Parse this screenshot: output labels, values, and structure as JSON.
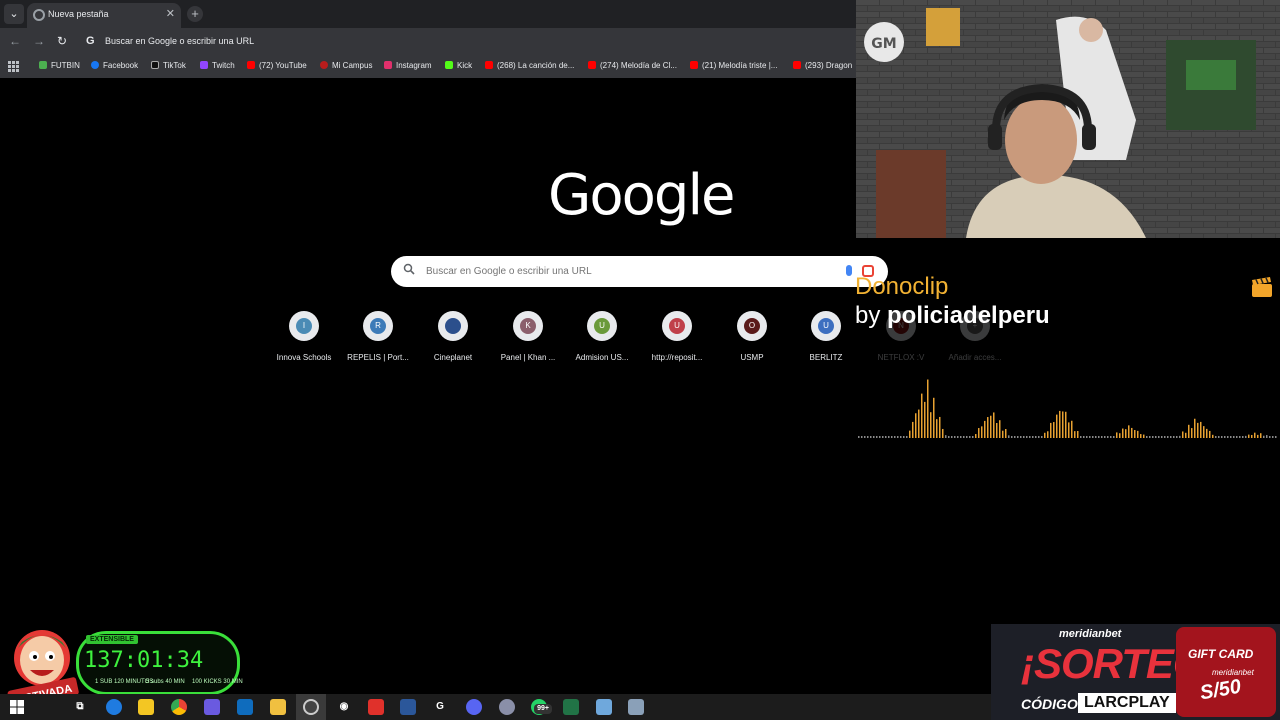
{
  "browser": {
    "tab_title": "Nueva pestaña",
    "tab_close": "✕",
    "new_tab": "+",
    "omnibox_text": "Buscar en Google o escribir una URL",
    "omnibox_g": "G",
    "bookmarks": [
      {
        "label": "FUTBIN",
        "color": "#4caf50"
      },
      {
        "label": "Facebook",
        "color": "#1877f2"
      },
      {
        "label": "TikTok",
        "color": "#000000"
      },
      {
        "label": "Twitch",
        "color": "#9146ff"
      },
      {
        "label": "(72) YouTube",
        "color": "#ff0000"
      },
      {
        "label": "Mi Campus",
        "color": "#b71c1c"
      },
      {
        "label": "Instagram",
        "color": "#e1306c"
      },
      {
        "label": "Kick",
        "color": "#53fc18"
      },
      {
        "label": "(268) La canción de...",
        "color": "#ff0000"
      },
      {
        "label": "(274) Melodía de Cl...",
        "color": "#ff0000"
      },
      {
        "label": "(21) Melodía triste |...",
        "color": "#ff0000"
      },
      {
        "label": "(293) Dragon",
        "color": "#ff0000"
      }
    ]
  },
  "newtab": {
    "logo": "Google",
    "search_placeholder": "Buscar en Google o escribir una URL",
    "shortcuts": [
      {
        "letter": "I",
        "label": "Innova Schools",
        "color": "#4a8bb5"
      },
      {
        "letter": "R",
        "label": "REPELIS | Port...",
        "color": "#3d7bb8"
      },
      {
        "letter": "",
        "label": "Cineplanet",
        "color": "#2b4f8c"
      },
      {
        "letter": "K",
        "label": "Panel | Khan ...",
        "color": "#8b5f6c"
      },
      {
        "letter": "U",
        "label": "Admision US...",
        "color": "#6a9a3a"
      },
      {
        "letter": "U",
        "label": "http://reposit...",
        "color": "#c0404a"
      },
      {
        "letter": "O",
        "label": "USMP",
        "color": "#5a1a1a"
      },
      {
        "letter": "U",
        "label": "BERLITZ",
        "color": "#3d6fc0"
      },
      {
        "letter": "N",
        "label": "NETFLOX :V",
        "color": "#8a1010"
      },
      {
        "letter": "+",
        "label": "Añadir acces...",
        "color": "#666666"
      }
    ]
  },
  "donoclip": {
    "title": "Donoclip",
    "by": "by ",
    "user": "policiadelperu"
  },
  "timer": {
    "badge": "EXTENSIBLE",
    "value": "137:01:34",
    "sub_label": "1 SUB\n120 MINUTOS",
    "bits_label": "5 subs\n40 MIN",
    "kicks_label": "100 KICKS\n30 MIN",
    "mascot_text": "ACTIVADA"
  },
  "sponsor": {
    "brand": "meridianbet",
    "headline": "¡SORTEO!",
    "code_label": "CÓDIGO:",
    "code": "LARCPLAY",
    "gift_title": "GIFT CARD",
    "gift_brand": "meridianbet",
    "gift_amount": "S/50"
  },
  "taskbar": {
    "badge_count": "99+"
  }
}
